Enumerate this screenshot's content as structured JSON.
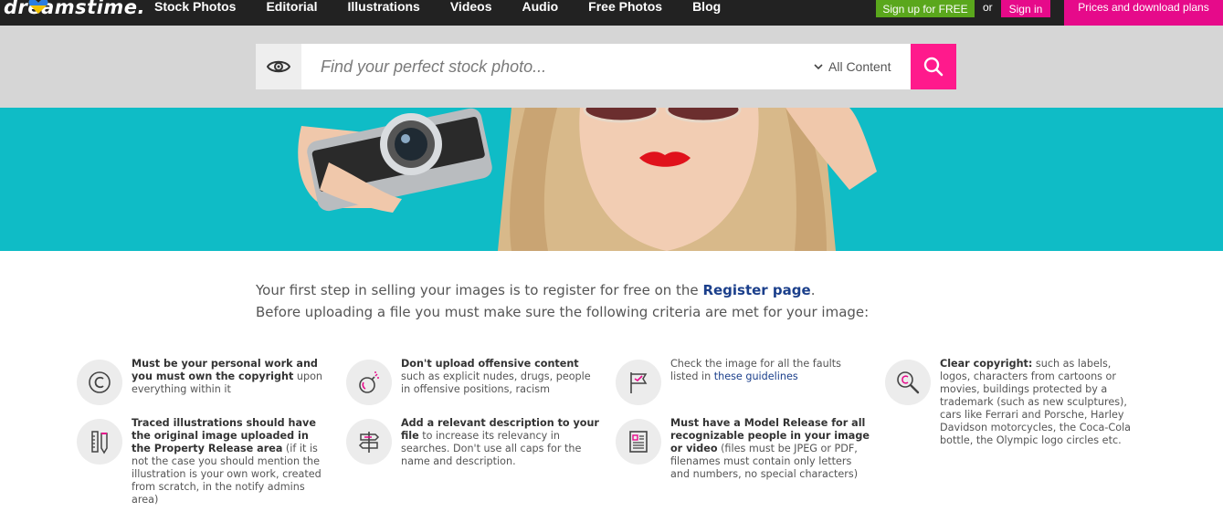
{
  "header": {
    "logo_text": "dreamstime.",
    "nav": [
      "Stock Photos",
      "Editorial",
      "Illustrations",
      "Videos",
      "Audio",
      "Free Photos",
      "Blog"
    ],
    "signup_label": "Sign up for FREE",
    "or_label": "or",
    "signin_label": "Sign in",
    "prices_label": "Prices and download plans"
  },
  "search": {
    "placeholder": "Find your perfect stock photo...",
    "filter_label": "All Content",
    "eye_icon": "eye-icon",
    "search_icon": "search-icon"
  },
  "intro": {
    "line1_prefix": "Your first step in selling your images is to register for free on the ",
    "register_link": "Register page",
    "line1_suffix": ".",
    "line2": "Before uploading a file you must make sure the following criteria are met for your image:"
  },
  "criteria": [
    {
      "icon": "copyright-icon",
      "bold": "Must be your personal work and you must own the copyright",
      "rest": " upon everything within it",
      "link": ""
    },
    {
      "icon": "bomb-icon",
      "bold": "Don't upload offensive content",
      "rest": " such as explicit nudes, drugs, people in offensive positions, racism",
      "link": ""
    },
    {
      "icon": "flag-icon",
      "bold": "",
      "rest": "Check the image for all the faults listed in ",
      "link": "these guidelines"
    },
    {
      "icon": "magnifier-copyright-icon",
      "bold": "Clear copyright:",
      "rest": " such as labels, logos, characters from cartoons or movies, buildings protected by a trademark (such as new sculptures), cars like Ferrari and Porsche, Harley Davidson motorcycles, the Coca-Cola bottle, the Olympic logo circles etc.",
      "link": ""
    },
    {
      "icon": "pencil-ruler-icon",
      "bold": "Traced illustrations should have the original image uploaded in the Property Release area",
      "rest": " (if it is not the case you should mention the illustration is your own work, created from scratch, in the notify admins area)",
      "link": ""
    },
    {
      "icon": "signpost-icon",
      "bold": "Add a relevant description to your file",
      "rest": " to increase its relevancy in searches. Don't use all caps for the name and description.",
      "link": ""
    },
    {
      "icon": "document-icon",
      "bold": "Must have a Model Release for all recognizable people in your image or video",
      "rest": " (files must be JPEG or PDF, filenames must contain only letters and numbers, no special characters)",
      "link": ""
    }
  ],
  "colors": {
    "accent": "#e60a8a",
    "signup": "#5aa71c",
    "hero_bg": "#0fbcc6",
    "link": "#1b3f8b"
  }
}
